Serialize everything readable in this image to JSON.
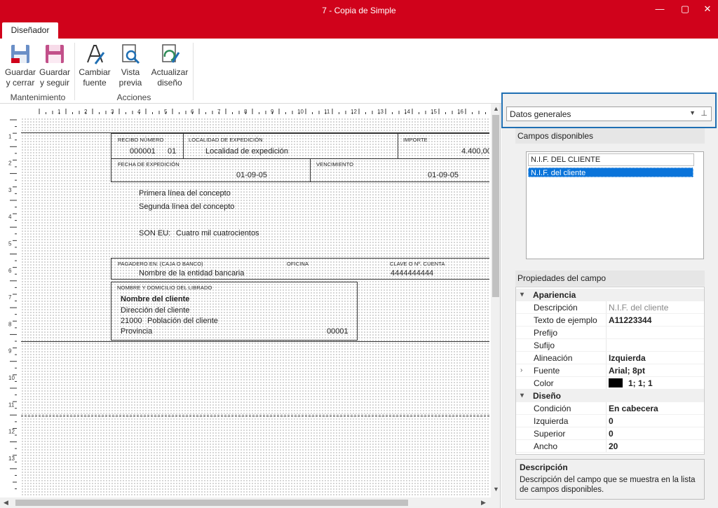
{
  "window": {
    "title": "7 - Copia de Simple",
    "minimize_icon": "minimize-icon",
    "maximize_icon": "maximize-icon",
    "close_icon": "close-icon"
  },
  "tabs": [
    {
      "label": "Diseñador",
      "active": true
    }
  ],
  "ribbon": {
    "groups": [
      {
        "label": "Mantenimiento"
      },
      {
        "label": "Acciones"
      }
    ],
    "buttons": {
      "guardar_cerrar": {
        "line1": "Guardar",
        "line2": "y cerrar"
      },
      "guardar_seguir": {
        "line1": "Guardar",
        "line2": "y seguir"
      },
      "cambiar_fuente": {
        "line1": "Cambiar",
        "line2": "fuente"
      },
      "vista_previa": {
        "line1": "Vista",
        "line2": "previa"
      },
      "actualizar_diseno": {
        "line1": "Actualizar",
        "line2": "diseño"
      }
    }
  },
  "ruler": {
    "h_numbers": [
      "1",
      "2",
      "3",
      "4",
      "5",
      "6",
      "7",
      "8",
      "9",
      "10",
      "11",
      "12",
      "13",
      "14",
      "15",
      "16",
      "17"
    ],
    "v_numbers": [
      "1",
      "2",
      "3",
      "4",
      "5",
      "6",
      "7",
      "8",
      "9",
      "10",
      "11",
      "12",
      "13",
      "14"
    ]
  },
  "report": {
    "recibo_numero_label": "RECIBO NÚMERO",
    "recibo_numero": "000001",
    "recibo_serie": "01",
    "localidad_label": "LOCALIDAD DE EXPEDICIÓN",
    "localidad": "Localidad de expedición",
    "importe_label": "IMPORTE",
    "importe": "4.400,00",
    "fecha_label": "FECHA DE EXPEDICIÓN",
    "fecha": "01-09-05",
    "vencimiento_label": "VENCIMIENTO",
    "vencimiento": "01-09-05",
    "concepto_1": "Primera línea del concepto",
    "concepto_2": "Segunda línea del concepto",
    "son_label": "SON EU:",
    "son_value": "Cuatro mil cuatrocientos",
    "pagadero_label": "PAGADERO EN: (CAJA O BANCO)",
    "oficina_label": "OFICINA",
    "clave_label": "CLAVE O Nº. CUENTA",
    "entidad": "Nombre de la entidad bancaria",
    "cuenta": "4444444444",
    "librado_label": "NOMBRE Y DOMICILIO DEL LIBRADO",
    "cliente_nombre": "Nombre del cliente",
    "cliente_direccion": "Dirección del cliente",
    "cliente_cp": "21000",
    "cliente_poblacion": "Población del cliente",
    "cliente_provincia": "Provincia",
    "cliente_codigo": "00001"
  },
  "panel": {
    "combo_value": "Datos generales",
    "campos_title": "Campos disponibles",
    "search_value": "N.I.F. DEL CLIENTE",
    "selected_item": "N.I.F. del cliente",
    "props_title": "Propiedades del campo",
    "apariencia": "Apariencia",
    "diseno": "Diseño",
    "props_apariencia": [
      {
        "key": "Descripción",
        "value": "N.I.F. del cliente",
        "dim": true
      },
      {
        "key": "Texto de ejemplo",
        "value": "A11223344"
      },
      {
        "key": "Prefijo",
        "value": ""
      },
      {
        "key": "Sufijo",
        "value": ""
      },
      {
        "key": "Alineación",
        "value": "Izquierda"
      },
      {
        "key": "Fuente",
        "value": "Arial; 8pt"
      },
      {
        "key": "Color",
        "value": "1; 1; 1"
      }
    ],
    "props_diseno": [
      {
        "key": "Condición",
        "value": "En cabecera"
      },
      {
        "key": "Izquierda",
        "value": "0"
      },
      {
        "key": "Superior",
        "value": "0"
      },
      {
        "key": "Ancho",
        "value": "20"
      }
    ],
    "desc_title": "Descripción",
    "desc_text": "Descripción del campo que se muestra en la lista de campos disponibles."
  },
  "colors": {
    "accent": "#d0021b",
    "selection": "#0a74da",
    "focus": "#1f6fb3"
  }
}
